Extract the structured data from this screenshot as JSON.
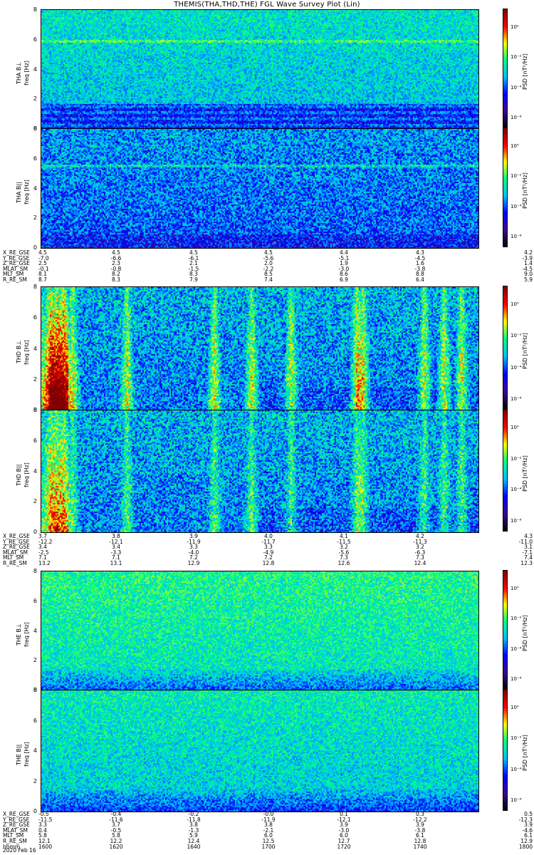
{
  "title": "THEMIS(THA,THD,THE) FGL Wave Survey Plot (Lin)",
  "chart_data": {
    "type": "heatmap",
    "x_axis": "hhmm",
    "y_range": [
      0,
      8
    ],
    "y_ticks": [
      "8",
      "6",
      "4",
      "2",
      "0"
    ],
    "panels": [
      {
        "probe": "THA",
        "label": "THA B⊥",
        "ylabel": "freq [Hz]",
        "colorbar_label": "PSD [nT²/Hz]",
        "colorbar_ticks": [
          "10⁰",
          "10⁻²",
          "10⁻⁴",
          "10⁻⁶"
        ]
      },
      {
        "probe": "THA",
        "label": "THA B||",
        "ylabel": "freq [Hz]",
        "colorbar_label": "PSD [nT²/Hz]",
        "colorbar_ticks": [
          "10⁰",
          "10⁻²",
          "10⁻⁴",
          "10⁻⁶"
        ]
      },
      {
        "probe": "THD",
        "label": "THD B⊥",
        "ylabel": "freq [Hz]",
        "colorbar_label": "PSD [nT²/Hz]",
        "colorbar_ticks": [
          "10⁰",
          "10⁻²",
          "10⁻⁴",
          "10⁻⁶"
        ]
      },
      {
        "probe": "THD",
        "label": "THD B||",
        "ylabel": "freq [Hz]",
        "colorbar_label": "PSD [nT²/Hz]",
        "colorbar_ticks": [
          "10⁰",
          "10⁻²",
          "10⁻⁴",
          "10⁻⁶"
        ]
      },
      {
        "probe": "THE",
        "label": "THE B⊥",
        "ylabel": "freq [Hz]",
        "colorbar_label": "PSD [nT²/Hz]",
        "colorbar_ticks": [
          "10⁰",
          "10⁻²",
          "10⁻⁴",
          "10⁻⁶"
        ]
      },
      {
        "probe": "THE",
        "label": "THE B||",
        "ylabel": "freq [Hz]",
        "colorbar_label": "PSD [nT²/Hz]",
        "colorbar_ticks": [
          "10⁰",
          "10⁻²",
          "10⁻⁴",
          "10⁻⁶"
        ]
      }
    ],
    "ephemeris": [
      {
        "probe": "THA",
        "rows": [
          {
            "label": "X_RE_GSE",
            "values": [
              "4.5",
              "4.5",
              "4.5",
              "4.5",
              "4.4",
              "4.3",
              "4.2"
            ]
          },
          {
            "label": "Y_RE_GSE",
            "values": [
              "-7.0",
              "-6.6",
              "-6.1",
              "-5.6",
              "-5.1",
              "-4.5",
              "-3.9"
            ]
          },
          {
            "label": "Z_RE_GSE",
            "values": [
              "2.5",
              "2.3",
              "2.1",
              "2.0",
              "1.9",
              "1.6",
              "1.4"
            ]
          },
          {
            "label": "MLAT_SM",
            "values": [
              "-0.1",
              "-0.8",
              "-1.5",
              "-2.2",
              "-3.0",
              "-3.8",
              "-4.5"
            ]
          },
          {
            "label": "MLT_SM",
            "values": [
              "8.1",
              "8.2",
              "8.3",
              "8.5",
              "8.6",
              "8.8",
              "9.0"
            ]
          },
          {
            "label": "R_RE_SM",
            "values": [
              "8.7",
              "8.3",
              "7.9",
              "7.4",
              "6.9",
              "6.4",
              "5.9"
            ]
          }
        ]
      },
      {
        "probe": "THD",
        "rows": [
          {
            "label": "X_RE_GSE",
            "values": [
              "3.7",
              "3.8",
              "3.9",
              "4.0",
              "4.1",
              "4.2",
              "4.3"
            ]
          },
          {
            "label": "Y_RE_GSE",
            "values": [
              "-12.2",
              "-12.1",
              "-11.9",
              "-11.7",
              "-11.5",
              "-11.3",
              "-11.0"
            ]
          },
          {
            "label": "Z_RE_GSE",
            "values": [
              "3.4",
              "3.4",
              "3.3",
              "3.3",
              "3.2",
              "3.2",
              "3.1"
            ]
          },
          {
            "label": "MLAT_SM",
            "values": [
              "-2.5",
              "-3.3",
              "-4.0",
              "-4.9",
              "-5.6",
              "-6.3",
              "-7.1"
            ]
          },
          {
            "label": "MLT_SM",
            "values": [
              "7.1",
              "7.1",
              "7.2",
              "7.2",
              "7.3",
              "7.3",
              "7.4"
            ]
          },
          {
            "label": "R_RE_SM",
            "values": [
              "13.2",
              "13.1",
              "12.9",
              "12.8",
              "12.6",
              "12.4",
              "12.3"
            ]
          }
        ]
      },
      {
        "probe": "THE",
        "rows": [
          {
            "label": "X_RE_GSE",
            "values": [
              "-0.5",
              "-0.4",
              "-0.2",
              "-0.0",
              "0.1",
              "0.3",
              "0.5"
            ]
          },
          {
            "label": "Y_RE_GSE",
            "values": [
              "-11.5",
              "-11.6",
              "-11.8",
              "-11.9",
              "-12.1",
              "-12.2",
              "-12.3"
            ]
          },
          {
            "label": "Z_RE_GSE",
            "values": [
              "3.3",
              "3.7",
              "3.8",
              "3.8",
              "3.9",
              "3.9",
              "3.9"
            ]
          },
          {
            "label": "MLAT_SM",
            "values": [
              "0.4",
              "-0.5",
              "-1.3",
              "-2.1",
              "-3.0",
              "-3.8",
              "-4.6"
            ]
          },
          {
            "label": "MLT_SM",
            "values": [
              "5.8",
              "5.8",
              "5.9",
              "6.0",
              "6.0",
              "6.1",
              "6.1"
            ]
          },
          {
            "label": "R_RE_SM",
            "values": [
              "12.1",
              "12.2",
              "12.4",
              "12.5",
              "12.7",
              "12.8",
              "12.9"
            ]
          },
          {
            "label": "hhmm",
            "values": [
              "1600",
              "1620",
              "1640",
              "1700",
              "1720",
              "1740",
              "1800"
            ]
          }
        ]
      }
    ],
    "date": "2020 Feb 16",
    "colormap": [
      "#000000",
      "#3d0a91",
      "#0000ff",
      "#00bfff",
      "#00ff80",
      "#ffff00",
      "#ff0000",
      "#7f0000"
    ]
  }
}
